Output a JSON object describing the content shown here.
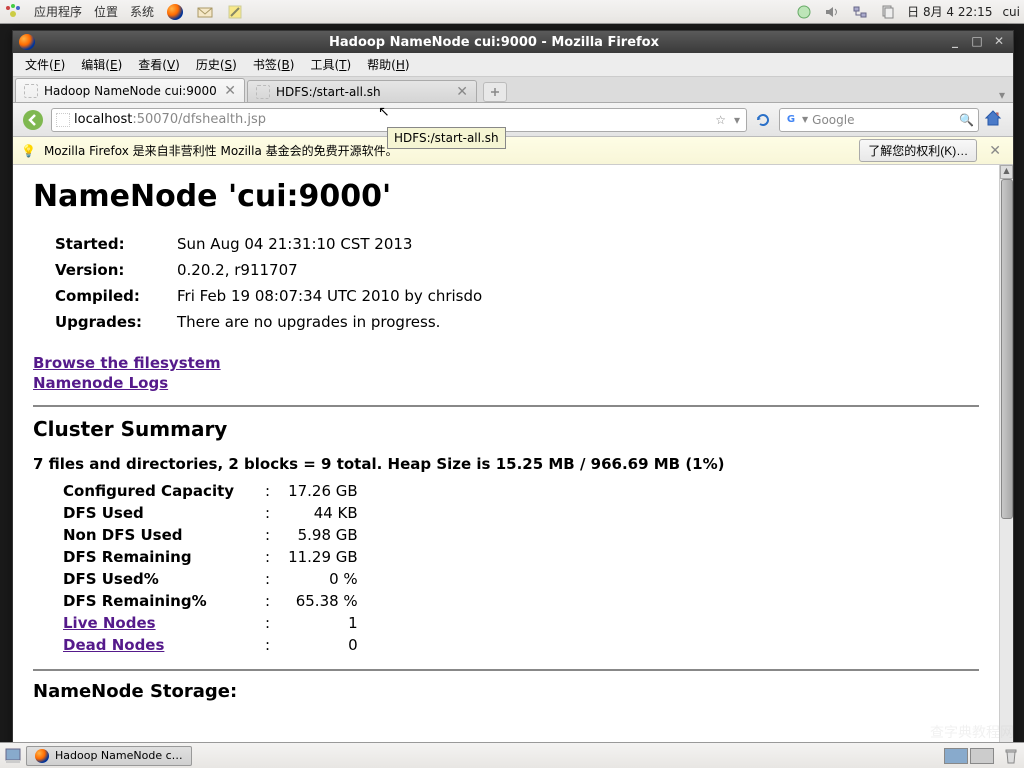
{
  "system_panel": {
    "menus": [
      "应用程序",
      "位置",
      "系统"
    ],
    "datetime": "日 8月  4 22:15",
    "user": "cui"
  },
  "firefox": {
    "title": "Hadoop NameNode cui:9000 - Mozilla Firefox",
    "menubar": [
      "文件(F)",
      "编辑(E)",
      "查看(V)",
      "历史(S)",
      "书签(B)",
      "工具(T)",
      "帮助(H)"
    ],
    "tabs": [
      {
        "label": "Hadoop NameNode cui:9000",
        "active": true
      },
      {
        "label": "HDFS:/start-all.sh",
        "active": false
      }
    ],
    "tooltip": "HDFS:/start-all.sh",
    "url": {
      "host": "localhost",
      "path": ":50070/dfshealth.jsp"
    },
    "search": {
      "engine": "Google",
      "placeholder": "Google"
    },
    "infobar": {
      "text": "Mozilla Firefox 是来自非营利性 Mozilla 基金会的免费开源软件。",
      "button": "了解您的权利(K)…"
    }
  },
  "page": {
    "heading": "NameNode 'cui:9000'",
    "info_rows": [
      {
        "label": "Started:",
        "value": "Sun Aug 04 21:31:10 CST 2013"
      },
      {
        "label": "Version:",
        "value": "0.20.2, r911707"
      },
      {
        "label": "Compiled:",
        "value": "Fri Feb 19 08:07:34 UTC 2010 by chrisdo"
      },
      {
        "label": "Upgrades:",
        "value": "There are no upgrades in progress."
      }
    ],
    "links": [
      "Browse the filesystem",
      "Namenode Logs"
    ],
    "cluster_heading": "Cluster Summary",
    "summary_line": "7 files and directories, 2 blocks = 9 total. Heap Size is 15.25 MB / 966.69 MB (1%)",
    "summary_rows": [
      {
        "label": "Configured Capacity",
        "sep": ":",
        "value": "17.26 GB",
        "link": false
      },
      {
        "label": "DFS Used",
        "sep": ":",
        "value": "44 KB",
        "link": false
      },
      {
        "label": "Non DFS Used",
        "sep": ":",
        "value": "5.98 GB",
        "link": false
      },
      {
        "label": "DFS Remaining",
        "sep": ":",
        "value": "11.29 GB",
        "link": false
      },
      {
        "label": "DFS Used%",
        "sep": ":",
        "value": "0 %",
        "link": false
      },
      {
        "label": "DFS Remaining%",
        "sep": ":",
        "value": "65.38 %",
        "link": false
      },
      {
        "label": "Live Nodes",
        "sep": ":",
        "value": "1",
        "link": true
      },
      {
        "label": "Dead Nodes",
        "sep": ":",
        "value": "0",
        "link": true
      }
    ],
    "storage_heading": "NameNode Storage:"
  },
  "taskbar": {
    "task": "Hadoop NameNode c…"
  },
  "watermark": "查字典教程网"
}
